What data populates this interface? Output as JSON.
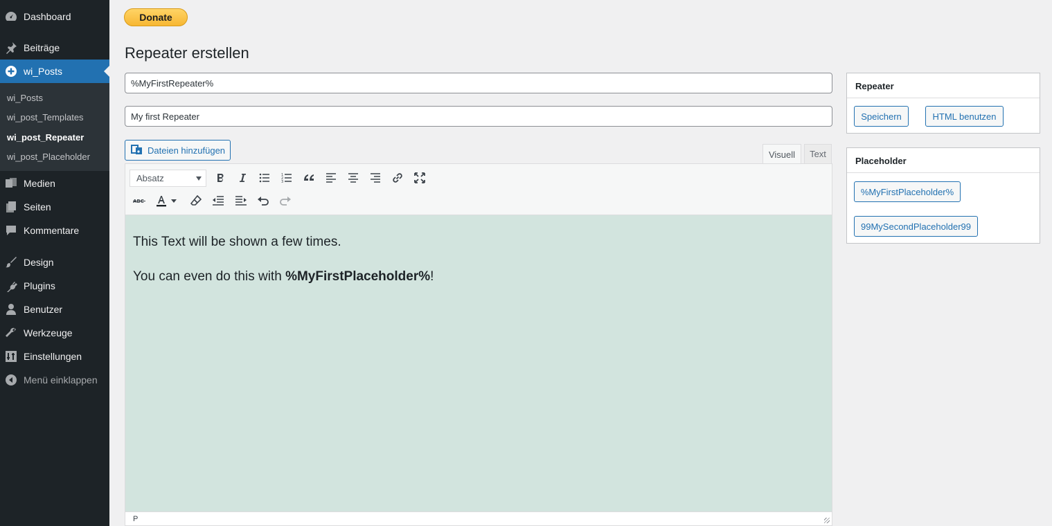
{
  "sidebar": {
    "items": [
      {
        "label": "Dashboard",
        "icon": "dashboard-icon"
      },
      {
        "label": "Beiträge",
        "icon": "pin-icon"
      },
      {
        "label": "wi_Posts",
        "icon": "plus-circle-icon",
        "active": true
      },
      {
        "label": "Medien",
        "icon": "media-icon"
      },
      {
        "label": "Seiten",
        "icon": "pages-icon"
      },
      {
        "label": "Kommentare",
        "icon": "comment-icon"
      },
      {
        "label": "Design",
        "icon": "brush-icon"
      },
      {
        "label": "Plugins",
        "icon": "plugin-icon"
      },
      {
        "label": "Benutzer",
        "icon": "user-icon"
      },
      {
        "label": "Werkzeuge",
        "icon": "wrench-icon"
      },
      {
        "label": "Einstellungen",
        "icon": "settings-icon"
      },
      {
        "label": "Menü einklappen",
        "icon": "collapse-icon"
      }
    ],
    "submenu": [
      "wi_Posts",
      "wi_post_Templates",
      "wi_post_Repeater",
      "wi_post_Placeholder"
    ],
    "submenu_current": "wi_post_Repeater"
  },
  "donate_label": "Donate",
  "page_title": "Repeater erstellen",
  "fields": {
    "slug_value": "%MyFirstRepeater%",
    "title_value": "My first Repeater"
  },
  "editor": {
    "add_media_label": "Dateien hinzufügen",
    "tab_visual": "Visuell",
    "tab_text": "Text",
    "format_value": "Absatz",
    "content": {
      "line1": "This Text will be shown a few times.",
      "line2_prefix": "You can even do this with ",
      "line2_bold": "%MyFirstPlaceholder%",
      "line2_suffix": "!"
    },
    "status_path": "P",
    "background_color": "#d2e4de"
  },
  "repeater_box": {
    "title": "Repeater",
    "save_label": "Speichern",
    "html_label": "HTML benutzen"
  },
  "placeholder_box": {
    "title": "Placeholder",
    "items": [
      "%MyFirstPlaceholder%",
      "99MySecondPlaceholder99"
    ]
  },
  "colors": {
    "sidebar_bg": "#1d2327",
    "accent": "#2271b1"
  }
}
